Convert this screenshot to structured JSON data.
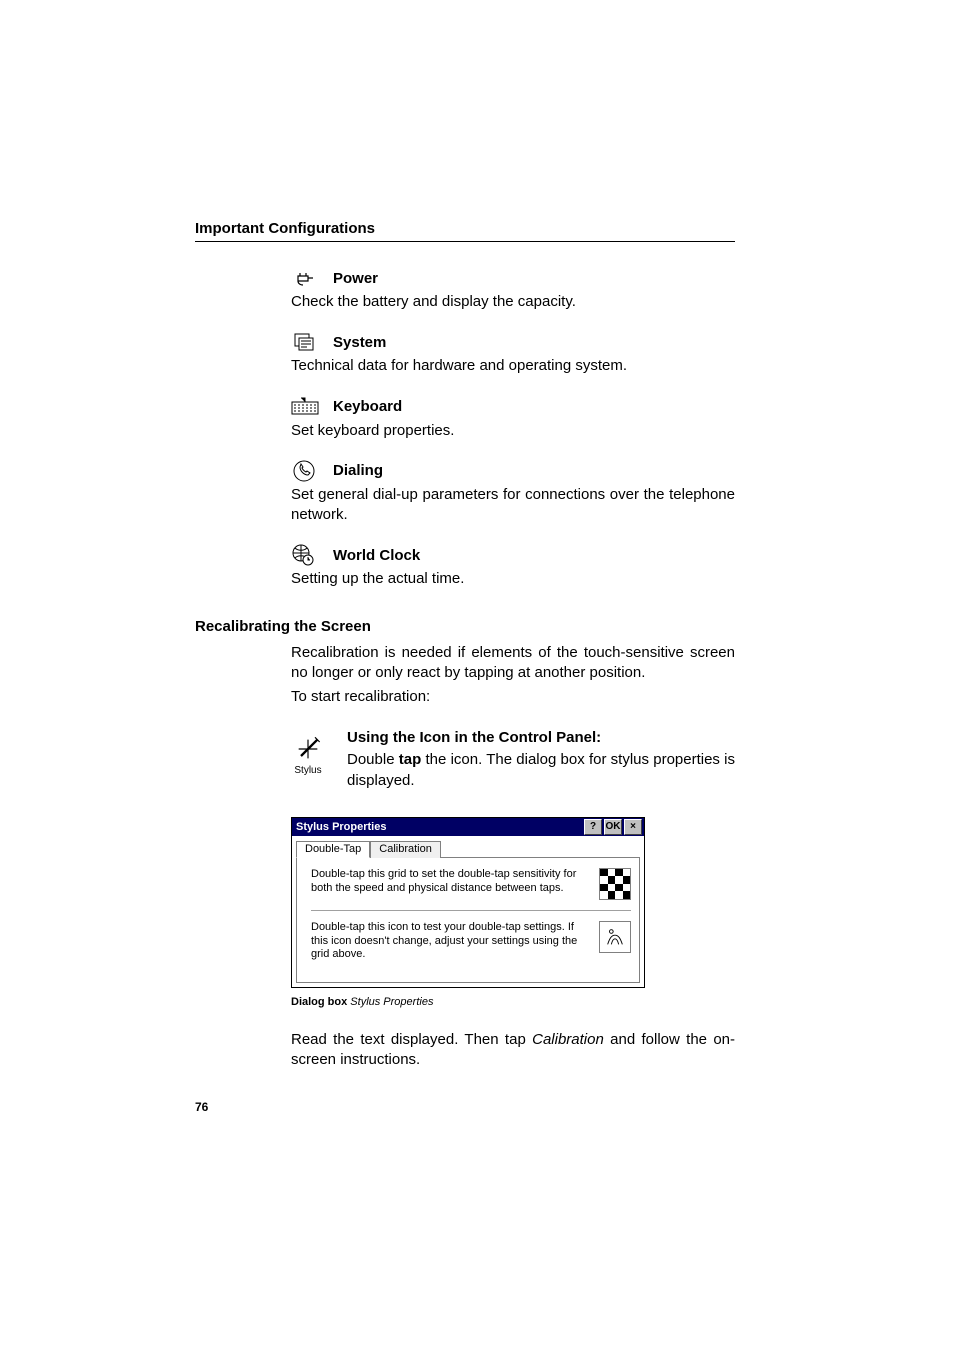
{
  "header": {
    "title": "Important Configurations"
  },
  "items": [
    {
      "label": "Power",
      "desc": "Check the battery and display the capacity.",
      "icon": "power-plug-icon"
    },
    {
      "label": "System",
      "desc": "Technical data for hardware and operating system.",
      "icon": "system-icon"
    },
    {
      "label": "Keyboard",
      "desc": "Set keyboard properties.",
      "icon": "keyboard-icon"
    },
    {
      "label": "Dialing",
      "desc": "Set general dial-up parameters for connections over the telephone network.",
      "icon": "phone-icon"
    },
    {
      "label": "World Clock",
      "desc": "Setting up the actual time.",
      "icon": "globe-clock-icon"
    }
  ],
  "recal": {
    "heading": "Recalibrating the Screen",
    "p1": "Recalibration is needed if elements of the touch-sensitive screen no longer or only react by tapping at another position.",
    "p2": "To start recalibration:"
  },
  "stylus": {
    "icon_caption": "Stylus",
    "heading": "Using the Icon in the Control Panel:",
    "body_pre": "Double ",
    "body_bold": "tap",
    "body_post": " the icon. The dialog box for stylus properties is displayed."
  },
  "dialog": {
    "title": "Stylus Properties",
    "btn_help": "?",
    "btn_ok": "OK",
    "btn_close": "×",
    "tabs": {
      "active": "Double-Tap",
      "other": "Calibration"
    },
    "row1": "Double-tap this grid to set the double-tap sensitivity for both the speed and physical distance between taps.",
    "row2": "Double-tap this icon to test your double-tap settings. If this icon doesn't change, adjust your settings using the grid above."
  },
  "caption": {
    "bold": "Dialog box",
    "italic": "Stylus Properties"
  },
  "final": {
    "pre": "Read the text displayed. Then tap ",
    "italic": "Calibration",
    "post": " and follow the on-screen instructions."
  },
  "page_number": "76"
}
